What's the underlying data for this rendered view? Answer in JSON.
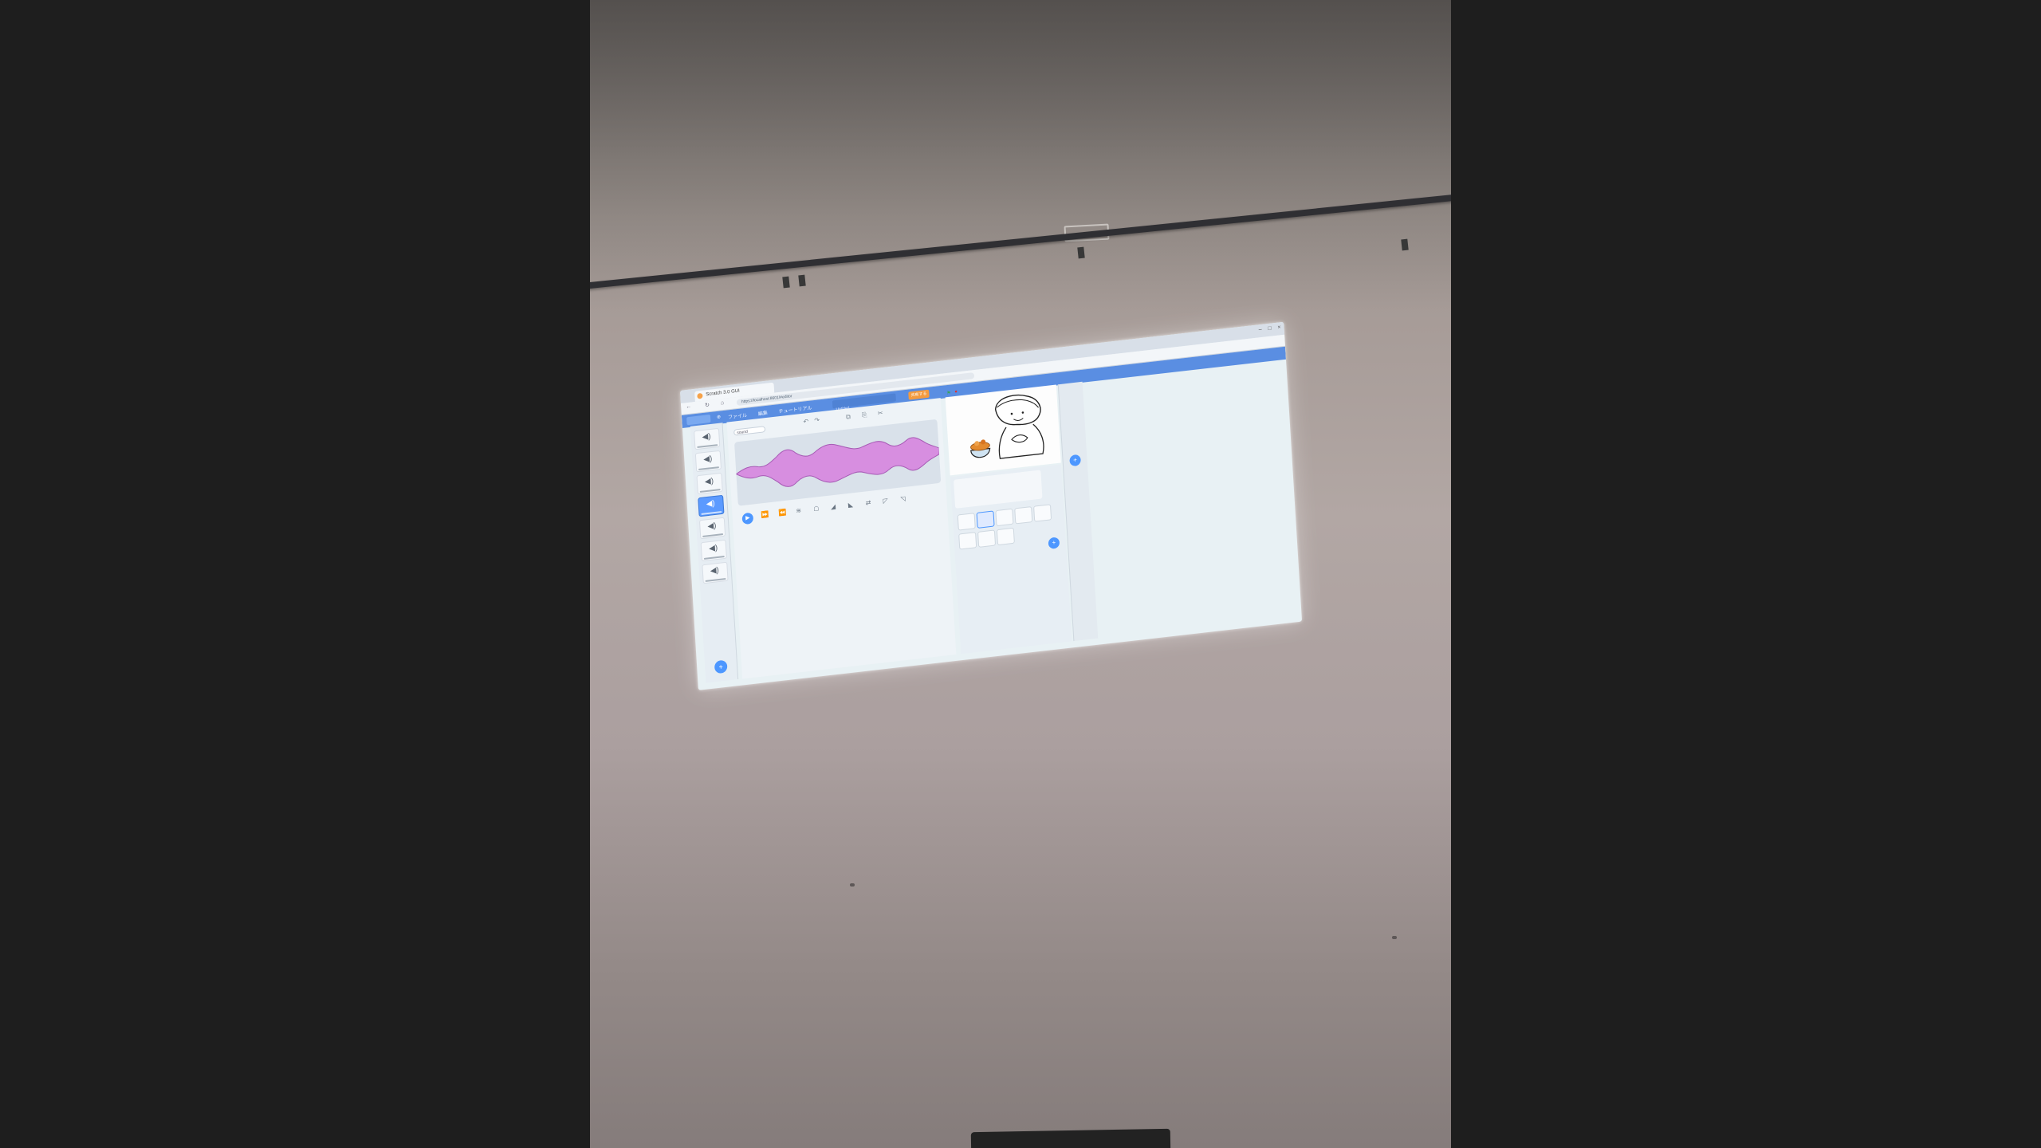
{
  "photo": {
    "subject": "wall projection of a sound editor in a block coding app"
  },
  "browser": {
    "tab_title": "Scratch 3.0 GUI",
    "url": "https://localhost:8601/#editor",
    "window_controls": [
      "–",
      "□",
      "×"
    ]
  },
  "menu": {
    "items": [
      "ファイル",
      "編集",
      "チュートリアル"
    ],
    "share_label": "共有する",
    "project_title": "Untitled"
  },
  "editor": {
    "sound_name": "sound",
    "sounds": [
      {
        "icon": "speaker-icon",
        "selected": false
      },
      {
        "icon": "speaker-icon",
        "selected": false
      },
      {
        "icon": "speaker-icon",
        "selected": false
      },
      {
        "icon": "speaker-icon",
        "selected": true
      },
      {
        "icon": "speaker-icon",
        "selected": false
      },
      {
        "icon": "speaker-icon",
        "selected": false
      },
      {
        "icon": "speaker-icon",
        "selected": false
      }
    ],
    "waveform_color": "#d78ee0",
    "play_icon": "play-icon",
    "effect_icons": [
      "faster-icon",
      "slower-icon",
      "echo-icon",
      "robot-icon",
      "louder-icon",
      "softer-icon",
      "reverse-icon",
      "fade-in-icon",
      "fade-out-icon"
    ]
  },
  "stage": {
    "sprite": "character holding a bowl",
    "sprite_thumbnails": 9
  },
  "colors": {
    "accent": "#4d97ff",
    "menu_bar": "#5a8ee2",
    "share": "#f49b3f"
  }
}
